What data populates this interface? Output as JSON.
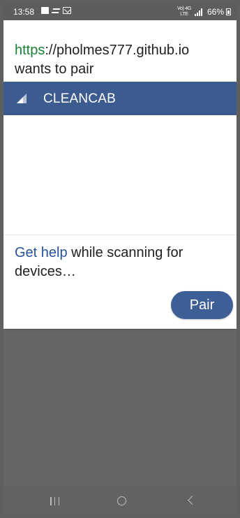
{
  "status_bar": {
    "time": "13:58",
    "network_label": "Vo) 4G\nLTE",
    "battery": "66%"
  },
  "dialog": {
    "origin_scheme": "https",
    "origin_rest": "://pholmes777.github.io",
    "request_text": "wants to pair",
    "selected_device": {
      "name": "CLEANCAB",
      "icon": "bluetooth-signal-icon"
    },
    "help": {
      "link_text": "Get help",
      "message": " while scanning for devices…"
    },
    "pair_button": "Pair"
  },
  "navigation": {
    "recent_apps_icon": "recent-apps-icon",
    "home_icon": "home-icon",
    "back_icon": "back-icon"
  },
  "colors": {
    "scheme_green": "#188038",
    "selected_blue": "#3c5b8f",
    "link_blue": "#24539a"
  }
}
